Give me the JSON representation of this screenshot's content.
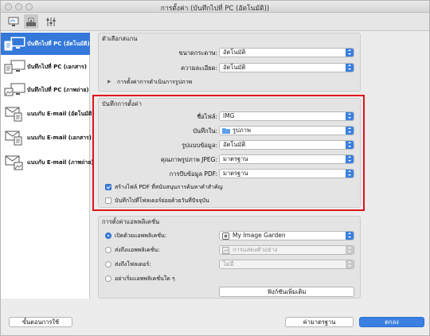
{
  "window": {
    "title": "การตั้งค่า (บันทึกไปที่ PC (อัตโนมัติ))"
  },
  "toolbar": {
    "icons": [
      "scan-from-computer-icon",
      "scan-from-panel-icon",
      "general-settings-icon"
    ]
  },
  "sidebar": {
    "items": [
      {
        "label": "บันทึกไปที่ PC (อัตโนมัติ)",
        "icon": "pc-auto-icon",
        "selected": true
      },
      {
        "label": "บันทึกไปที่ PC (เอกสาร)",
        "icon": "pc-document-icon",
        "selected": false
      },
      {
        "label": "บันทึกไปที่ PC (ภาพถ่าย)",
        "icon": "pc-photo-icon",
        "selected": false
      },
      {
        "label": "แนบกับ E-mail (อัตโนมัติ)",
        "icon": "email-auto-icon",
        "selected": false
      },
      {
        "label": "แนบกับ E-mail (เอกสาร)",
        "icon": "email-document-icon",
        "selected": false
      },
      {
        "label": "แนบกับ E-mail (ภาพถ่าย)",
        "icon": "email-photo-icon",
        "selected": false
      }
    ]
  },
  "scan_options": {
    "title": "ตัวเลือกสแกน",
    "paper_size_label": "ขนาดกระดาษ:",
    "paper_size_value": "อัตโนมัติ",
    "resolution_label": "ความละเอียด:",
    "resolution_value": "อัตโนมัติ",
    "image_processing_label": "การตั้งค่าการดำเนินการรูปภาพ"
  },
  "save_settings": {
    "title": "บันทึกการตั้งค่า",
    "file_name_label": "ชื่อไฟล์:",
    "file_name_value": "IMG",
    "save_in_label": "บันทึกใน:",
    "save_in_value": "รูปภาพ",
    "data_format_label": "รูปแบบข้อมูล:",
    "data_format_value": "อัตโนมัติ",
    "jpeg_quality_label": "คุณภาพรูปภาพ JPEG:",
    "jpeg_quality_value": "มาตรฐาน",
    "pdf_compression_label": "การบีบข้อมูล PDF:",
    "pdf_compression_value": "มาตรฐาน",
    "keyword_pdf_label": "สร้างไฟล์ PDF ที่สนับสนุนการค้นหาคำสำคัญ",
    "keyword_pdf_checked": true,
    "subfolder_label": "บันทึกไปที่โฟลเดอร์ย่อยด้วยวันที่ปัจจุบัน",
    "subfolder_checked": false
  },
  "app_settings": {
    "title": "การตั้งค่าแอพพลิเคชั่น",
    "open_with_label": "เปิดด้วยแอพพลิเคชั่น:",
    "open_with_value": "My Image Garden",
    "send_to_app_label": "ส่งถึงแอพพลิเคชั่น:",
    "send_to_app_value": "การแสดงตัวอย่าง",
    "send_to_folder_label": "ส่งถึงโฟลเดอร์:",
    "send_to_folder_value": "ไม่มี",
    "do_not_start_label": "อย่าเริ่มแอพพลิเคชั่นใด ๆ",
    "more_functions_label": "ฟังก์ชันเพิ่มเติม",
    "selected_option": "open_with"
  },
  "footer": {
    "instructions_label": "ขั้นตอนการใช้",
    "defaults_label": "ค่ามาตรฐาน",
    "ok_label": "ตกลง"
  },
  "colors": {
    "accent": "#3a7fe2",
    "selection": "#3478d9",
    "highlight_box": "#e0141c"
  }
}
